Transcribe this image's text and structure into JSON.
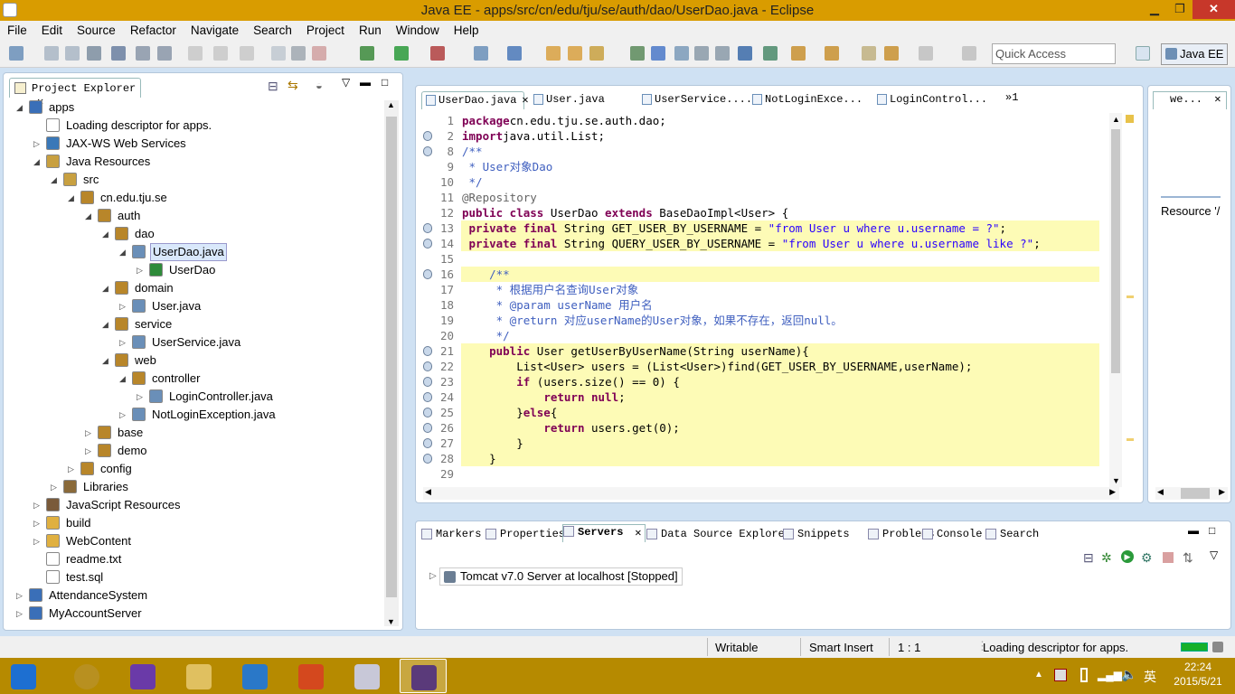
{
  "window": {
    "title": "Java EE - apps/src/cn/edu/tju/se/auth/dao/UserDao.java - Eclipse"
  },
  "menu": [
    "File",
    "Edit",
    "Source",
    "Refactor",
    "Navigate",
    "Search",
    "Project",
    "Run",
    "Window",
    "Help"
  ],
  "toolbar": {
    "quick_access_placeholder": "Quick Access",
    "perspective": "Java EE"
  },
  "explorer": {
    "title": "Project Explorer",
    "tree": [
      {
        "label": "apps",
        "depth": 0,
        "exp": "open",
        "icon": "project-icon"
      },
      {
        "label": "Loading descriptor for apps.",
        "depth": 1,
        "exp": "none",
        "icon": "descriptor-icon"
      },
      {
        "label": "JAX-WS Web Services",
        "depth": 1,
        "exp": "closed",
        "icon": "webservice-icon"
      },
      {
        "label": "Java Resources",
        "depth": 1,
        "exp": "open",
        "icon": "java-resources-icon"
      },
      {
        "label": "src",
        "depth": 2,
        "exp": "open",
        "icon": "source-folder-icon"
      },
      {
        "label": "cn.edu.tju.se",
        "depth": 3,
        "exp": "open",
        "icon": "package-icon"
      },
      {
        "label": "auth",
        "depth": 4,
        "exp": "open",
        "icon": "package-icon"
      },
      {
        "label": "dao",
        "depth": 5,
        "exp": "open",
        "icon": "package-icon"
      },
      {
        "label": "UserDao.java",
        "depth": 6,
        "exp": "open",
        "icon": "java-file-icon",
        "selected": true
      },
      {
        "label": "UserDao",
        "depth": 7,
        "exp": "closed",
        "icon": "class-icon"
      },
      {
        "label": "domain",
        "depth": 5,
        "exp": "open",
        "icon": "package-icon"
      },
      {
        "label": "User.java",
        "depth": 6,
        "exp": "closed",
        "icon": "java-file-icon"
      },
      {
        "label": "service",
        "depth": 5,
        "exp": "open",
        "icon": "package-icon"
      },
      {
        "label": "UserService.java",
        "depth": 6,
        "exp": "closed",
        "icon": "java-file-icon"
      },
      {
        "label": "web",
        "depth": 5,
        "exp": "open",
        "icon": "package-icon"
      },
      {
        "label": "controller",
        "depth": 6,
        "exp": "open",
        "icon": "package-icon"
      },
      {
        "label": "LoginController.java",
        "depth": 7,
        "exp": "closed",
        "icon": "java-file-icon"
      },
      {
        "label": "NotLoginException.java",
        "depth": 6,
        "exp": "closed",
        "icon": "java-file-icon"
      },
      {
        "label": "base",
        "depth": 4,
        "exp": "closed",
        "icon": "package-icon"
      },
      {
        "label": "demo",
        "depth": 4,
        "exp": "closed",
        "icon": "package-icon"
      },
      {
        "label": "config",
        "depth": 3,
        "exp": "closed",
        "icon": "package-icon"
      },
      {
        "label": "Libraries",
        "depth": 2,
        "exp": "closed",
        "icon": "libraries-icon"
      },
      {
        "label": "JavaScript Resources",
        "depth": 1,
        "exp": "closed",
        "icon": "js-resources-icon"
      },
      {
        "label": "build",
        "depth": 1,
        "exp": "closed",
        "icon": "folder-icon"
      },
      {
        "label": "WebContent",
        "depth": 1,
        "exp": "closed",
        "icon": "folder-icon"
      },
      {
        "label": "readme.txt",
        "depth": 1,
        "exp": "none",
        "icon": "text-file-icon"
      },
      {
        "label": "test.sql",
        "depth": 1,
        "exp": "none",
        "icon": "text-file-icon"
      },
      {
        "label": "AttendanceSystem",
        "depth": 0,
        "exp": "closed",
        "icon": "project-icon"
      },
      {
        "label": "MyAccountServer",
        "depth": 0,
        "exp": "closed",
        "icon": "project-icon"
      }
    ]
  },
  "editor": {
    "tabs": [
      "UserDao.java",
      "User.java",
      "UserService....",
      "NotLoginExce...",
      "LoginControl..."
    ],
    "overflow": "»1",
    "side_tab": "we...",
    "side_text": "Resource '/",
    "lines": [
      {
        "n": "1",
        "hl": false,
        "seg": [
          [
            "kw",
            "package"
          ],
          [
            "",
            "cn.edu.tju.se.auth.dao;"
          ]
        ]
      },
      {
        "n": "2",
        "hl": false,
        "seg": [
          [
            "kw",
            "import"
          ],
          [
            "",
            "java.util.List;"
          ]
        ]
      },
      {
        "n": "8",
        "hl": false,
        "seg": [
          [
            "cm",
            "/**"
          ]
        ]
      },
      {
        "n": "9",
        "hl": false,
        "seg": [
          [
            "cm",
            " * User对象Dao"
          ]
        ]
      },
      {
        "n": "10",
        "hl": false,
        "seg": [
          [
            "cm",
            " */"
          ]
        ]
      },
      {
        "n": "11",
        "hl": false,
        "seg": [
          [
            "an",
            "@Repository"
          ]
        ]
      },
      {
        "n": "12",
        "hl": false,
        "seg": [
          [
            "kw",
            "public class"
          ],
          [
            "",
            " UserDao "
          ],
          [
            "kw",
            "extends"
          ],
          [
            "",
            " BaseDaoImpl<User> {"
          ]
        ]
      },
      {
        "n": "13",
        "hl": true,
        "seg": [
          [
            "",
            " "
          ],
          [
            "kw",
            "private final"
          ],
          [
            "",
            " String GET_USER_BY_USERNAME = "
          ],
          [
            "st",
            "\"from User u where u.username = ?\""
          ],
          [
            "",
            ";"
          ]
        ]
      },
      {
        "n": "14",
        "hl": true,
        "seg": [
          [
            "",
            " "
          ],
          [
            "kw",
            "private final"
          ],
          [
            "",
            " String QUERY_USER_BY_USERNAME = "
          ],
          [
            "st",
            "\"from User u where u.username like ?\""
          ],
          [
            "",
            ";"
          ]
        ]
      },
      {
        "n": "15",
        "hl": false,
        "seg": []
      },
      {
        "n": "16",
        "hl": true,
        "seg": [
          [
            "cm",
            "    /**"
          ]
        ]
      },
      {
        "n": "17",
        "hl": false,
        "seg": [
          [
            "cm",
            "     * 根据用户名查询User对象"
          ]
        ]
      },
      {
        "n": "18",
        "hl": false,
        "seg": [
          [
            "cm",
            "     * @param userName 用户名"
          ]
        ]
      },
      {
        "n": "19",
        "hl": false,
        "seg": [
          [
            "cm",
            "     * @return 对应userName的User对象，如果不存在，返回null。"
          ]
        ]
      },
      {
        "n": "20",
        "hl": false,
        "seg": [
          [
            "cm",
            "     */"
          ]
        ]
      },
      {
        "n": "21",
        "hl": true,
        "seg": [
          [
            "",
            "    "
          ],
          [
            "kw",
            "public"
          ],
          [
            "",
            " User getUserByUserName(String userName){"
          ]
        ]
      },
      {
        "n": "22",
        "hl": true,
        "seg": [
          [
            "",
            "        List<User> users = (List<User>)find(GET_USER_BY_USERNAME,userName);"
          ]
        ]
      },
      {
        "n": "23",
        "hl": true,
        "seg": [
          [
            "",
            "        "
          ],
          [
            "kw",
            "if"
          ],
          [
            "",
            " (users.size() == 0) {"
          ]
        ]
      },
      {
        "n": "24",
        "hl": true,
        "seg": [
          [
            "",
            "            "
          ],
          [
            "kw",
            "return null"
          ],
          [
            "",
            ";"
          ]
        ]
      },
      {
        "n": "25",
        "hl": true,
        "seg": [
          [
            "",
            "        }"
          ],
          [
            "kw",
            "else"
          ],
          [
            "",
            "{"
          ]
        ]
      },
      {
        "n": "26",
        "hl": true,
        "seg": [
          [
            "",
            "            "
          ],
          [
            "kw",
            "return"
          ],
          [
            "",
            " users.get(0);"
          ]
        ]
      },
      {
        "n": "27",
        "hl": true,
        "seg": [
          [
            "",
            "        }"
          ]
        ]
      },
      {
        "n": "28",
        "hl": true,
        "seg": [
          [
            "",
            "    }"
          ]
        ]
      },
      {
        "n": "29",
        "hl": false,
        "seg": []
      }
    ]
  },
  "bottom": {
    "tabs": [
      "Markers",
      "Properties",
      "Servers",
      "Data Source Explorer",
      "Snippets",
      "Problems",
      "Console",
      "Search"
    ],
    "server": "Tomcat v7.0 Server at localhost  [Stopped]"
  },
  "status": {
    "writable": "Writable",
    "insert": "Smart Insert",
    "position": "1 : 1",
    "message": "Loading descriptor for apps."
  },
  "taskbar": {
    "time": "22:24",
    "date": "2015/5/21",
    "ime": "英",
    "apps": [
      "explorer-icon",
      "chrome-icon",
      "visual-studio-icon",
      "file-manager-icon",
      "notepad-icon",
      "powerpoint-icon",
      "paint-icon",
      "eclipse-icon"
    ]
  }
}
